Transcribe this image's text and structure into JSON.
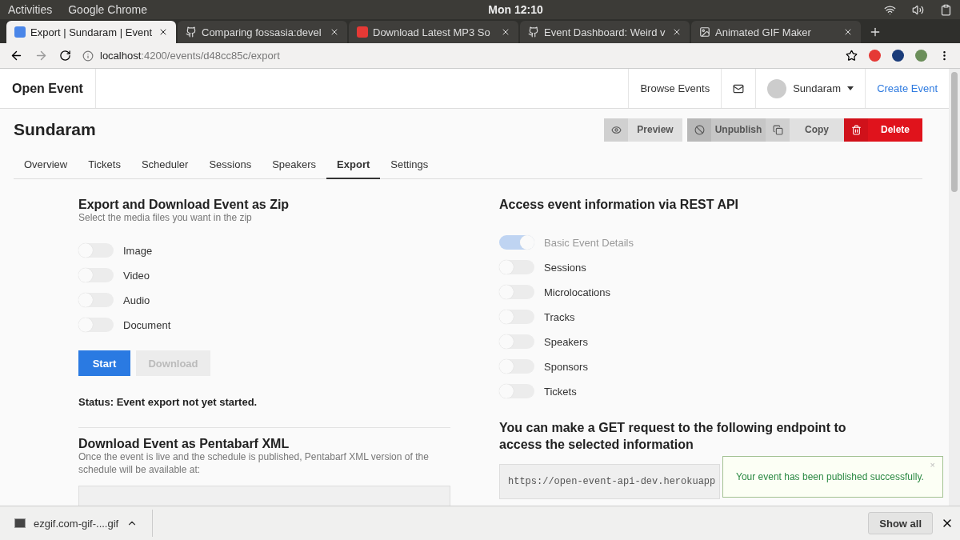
{
  "system_bar": {
    "activities": "Activities",
    "app": "Google Chrome",
    "clock": "Mon 12:10"
  },
  "browser_tabs": [
    {
      "title": "Export | Sundaram | Event",
      "selected": true
    },
    {
      "title": "Comparing fossasia:devel",
      "selected": false
    },
    {
      "title": "Download Latest MP3 So",
      "selected": false
    },
    {
      "title": "Event Dashboard: Weird v",
      "selected": false
    },
    {
      "title": "Animated GIF Maker",
      "selected": false
    }
  ],
  "address_bar": {
    "host": "localhost",
    "path": ":4200/events/d48cc85c/export"
  },
  "app_header": {
    "brand": "Open Event",
    "browse": "Browse Events",
    "user": "Sundaram",
    "create": "Create Event"
  },
  "event": {
    "title": "Sundaram",
    "actions": [
      {
        "label": "Preview",
        "kind": "preview"
      },
      {
        "label": "Unpublish",
        "kind": "unpublish"
      },
      {
        "label": "Copy",
        "kind": "copy"
      },
      {
        "label": "Delete",
        "kind": "delete"
      }
    ]
  },
  "tabs": [
    {
      "label": "Overview",
      "selected": false
    },
    {
      "label": "Tickets",
      "selected": false
    },
    {
      "label": "Scheduler",
      "selected": false
    },
    {
      "label": "Sessions",
      "selected": false
    },
    {
      "label": "Speakers",
      "selected": false
    },
    {
      "label": "Export",
      "selected": true
    },
    {
      "label": "Settings",
      "selected": false
    }
  ],
  "zip_export": {
    "title": "Export and Download Event as Zip",
    "subtitle": "Select the media files you want in the zip",
    "options": [
      {
        "label": "Image",
        "checked": false
      },
      {
        "label": "Video",
        "checked": false
      },
      {
        "label": "Audio",
        "checked": false
      },
      {
        "label": "Document",
        "checked": false
      }
    ],
    "buttons": [
      {
        "label": "Start",
        "disabled": false
      },
      {
        "label": "Download",
        "disabled": true
      }
    ],
    "status": "Status: Event export not yet started."
  },
  "pentabarf": {
    "title": "Download Event as Pentabarf XML",
    "description": "Once the event is live and the schedule is published, Pentabarf XML version of the schedule will be available at:"
  },
  "rest_api": {
    "title": "Access event information via REST API",
    "options": [
      {
        "label": "Basic Event Details",
        "checked": true,
        "disabled": true
      },
      {
        "label": "Sessions",
        "checked": false,
        "disabled": false
      },
      {
        "label": "Microlocations",
        "checked": false,
        "disabled": false
      },
      {
        "label": "Tracks",
        "checked": false,
        "disabled": false
      },
      {
        "label": "Speakers",
        "checked": false,
        "disabled": false
      },
      {
        "label": "Sponsors",
        "checked": false,
        "disabled": false
      },
      {
        "label": "Tickets",
        "checked": false,
        "disabled": false
      }
    ],
    "endpoint_title": "You can make a GET request to the following endpoint to access the selected information",
    "endpoint": "https://open-event-api-dev.herokuapp"
  },
  "toast": {
    "message": "Your event has been published successfully.",
    "close": "×"
  },
  "download_bar": {
    "file": "ezgif.com-gif-....gif",
    "show_all": "Show all"
  }
}
